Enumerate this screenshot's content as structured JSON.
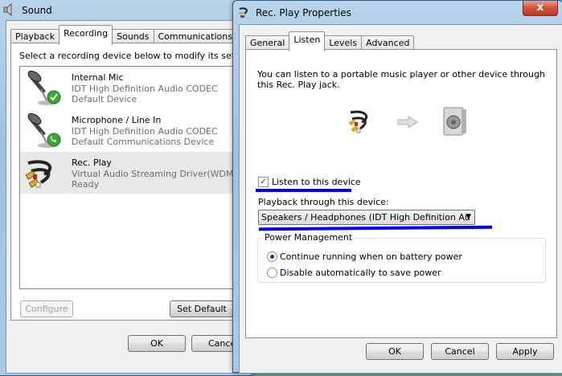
{
  "sound_window": {
    "title": "Sound",
    "close": "x",
    "tabs": [
      "Playback",
      "Recording",
      "Sounds",
      "Communications"
    ],
    "active_tab": "Recording",
    "instruction": "Select a recording device below to modify its settin",
    "devices": [
      {
        "name": "Internal Mic",
        "line2": "IDT High Definition Audio CODEC",
        "line3": "Default Device",
        "icon": "microphone-icon",
        "status": "default-check"
      },
      {
        "name": "Microphone / Line In",
        "line2": "IDT High Definition Audio CODEC",
        "line3": "Default Communications Device",
        "icon": "microphone-icon",
        "status": "communications-phone"
      },
      {
        "name": "Rec. Play",
        "line2": "Virtual Audio Streaming Driver(WDM/D",
        "line3": "Ready",
        "icon": "rca-cable-icon",
        "selected": true
      }
    ],
    "buttons": {
      "configure": "Configure",
      "set_default": "Set Default",
      "ok": "OK",
      "cancel": "Cance"
    }
  },
  "props_window": {
    "title": "Rec. Play Properties",
    "close": "x",
    "tabs": [
      "General",
      "Listen",
      "Levels",
      "Advanced"
    ],
    "active_tab": "Listen",
    "description_line1": "You can listen to a portable music player or other device through",
    "description_line2": "this Rec. Play jack.",
    "listen_checkbox": {
      "label": "Listen to this device",
      "checked": true,
      "mark": "✓"
    },
    "playback_label": "Playback through this device:",
    "playback_value": "Speakers / Headphones (IDT High Definition Au",
    "power_group": "Power Management",
    "radios": [
      {
        "label": "Continue running when on battery power",
        "selected": true
      },
      {
        "label": "Disable automatically to save power",
        "selected": false
      }
    ],
    "buttons": {
      "ok": "OK",
      "cancel": "Cancel",
      "apply": "Apply"
    }
  },
  "colors": {
    "annotation": "#0000ff",
    "accent": "#3c7fb1"
  }
}
